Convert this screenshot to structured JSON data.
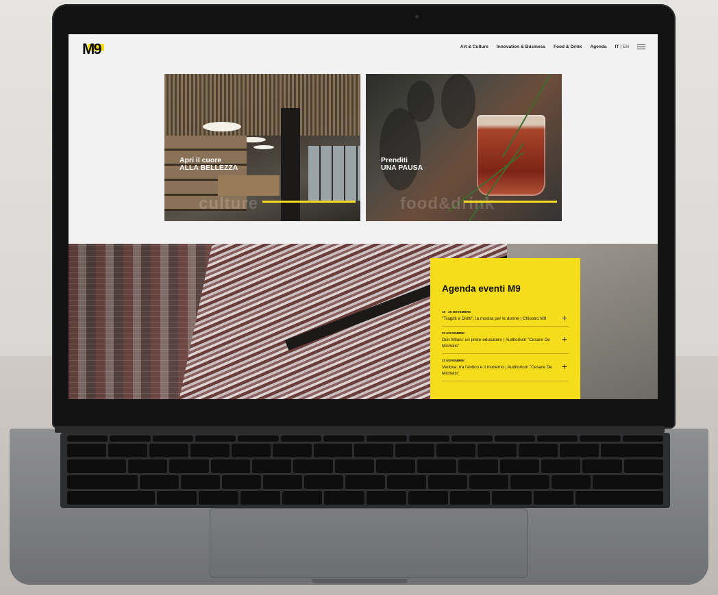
{
  "header": {
    "logo_text": "M9",
    "nav": [
      "Art & Culture",
      "Innovation & Business",
      "Food & Drink",
      "Agenda"
    ],
    "lang_it": "IT",
    "lang_sep": "|",
    "lang_en": "EN",
    "menu_icon": "hamburger-icon"
  },
  "cards": [
    {
      "line1": "Apri il cuore",
      "line2": "ALLA BELLEZZA",
      "watermark": "culture"
    },
    {
      "line1": "Prenditi",
      "line2": "UNA PAUSA",
      "watermark": "food&drink"
    }
  ],
  "agenda": {
    "title": "Agenda eventi M9",
    "events": [
      {
        "date": "18 - 26 NOVEMBRE",
        "name": "\"Tragitti e Diritti\", la mostra per le donne | Chiostro M9",
        "icon": "+"
      },
      {
        "date": "22 NOVEMBRE",
        "name": "Don Milani: un prete-educatore | Auditorium \"Cesare De Michelis\"",
        "icon": "+"
      },
      {
        "date": "23 NOVEMBRE",
        "name": "Vedova: tra l'antico e il moderno | Auditorium \"Cesare De Michelis\"",
        "icon": "+"
      }
    ]
  },
  "colors": {
    "accent": "#f6dd1b",
    "text": "#111111",
    "page_bg": "#f2f2f2"
  }
}
